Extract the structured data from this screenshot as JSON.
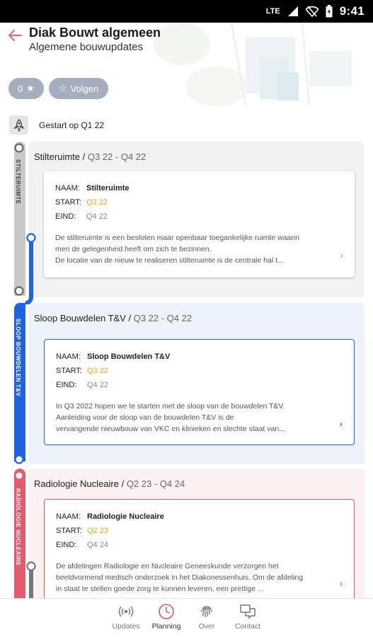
{
  "status_bar": {
    "network": "LTE",
    "time": "9:41"
  },
  "header": {
    "title": "Diak Bouwt algemeen",
    "subtitle": "Algemene bouwupdates",
    "rating_count": "0",
    "follow_label": "Volgen"
  },
  "timeline": {
    "start_label": "Gestart op Q1 22",
    "phases": [
      {
        "rail_label": "STILTERUIMTE",
        "title": "Stilteruimte",
        "dates": "Q3 22 - Q4 22",
        "card": {
          "name_key": "NAAM:",
          "name": "Stilteruimte",
          "start_key": "START:",
          "start": "Q3 22",
          "end_key": "EIND:",
          "end": "Q4 22",
          "desc1": "De stilteruimte is een besloten maar openbaar toegankelijke ruimte waarin",
          "desc2": "men de gelegenheid heeft om zich te bezinnen.",
          "desc3": "De locatie van de nieuw te realiseren stilteruimte is de centrale hal t..."
        }
      },
      {
        "rail_label": "SLOOP BOUWDELEN T&V",
        "title": "Sloop Bouwdelen T&V",
        "dates": "Q3 22 - Q4 22",
        "card": {
          "name_key": "NAAM:",
          "name": "Sloop Bouwdelen T&V",
          "start_key": "START:",
          "start": "Q3 22",
          "end_key": "EIND:",
          "end": "Q4 22",
          "desc1": "In Q3 2022 hopen we te starten met de sloop van de bouwdelen T&V.",
          "desc2": "Aanleiding voor de sloop van de bouwdelen T&V is de",
          "desc3": "vervangende nieuwbouw van VKC en klinieken en slechte staat van..."
        }
      },
      {
        "rail_label": "RADIOLOGIE NUCLEAIRE",
        "title": "Radiologie Nucleaire",
        "dates": "Q2 23 - Q4 24",
        "card": {
          "name_key": "NAAM:",
          "name": "Radiologie Nucleaire",
          "start_key": "START:",
          "start": "Q2 23",
          "end_key": "EIND:",
          "end": "Q4 24",
          "desc1": "De afdelingen Radiologie en Nucleaire Geneeskunde verzorgen het",
          "desc2": "beeldvormend medisch onderzoek in het Diakonessenhuis. Om de afdeling",
          "desc3": "in staat te stellen goede zorg te kunnen leveren, een prettige ..."
        }
      }
    ]
  },
  "bottom_nav": {
    "items": [
      {
        "label": "Updates"
      },
      {
        "label": "Planning"
      },
      {
        "label": "Over"
      },
      {
        "label": "Contact"
      }
    ]
  },
  "colors": {
    "accent": "#e06b75",
    "phase_grey": "#f2f2f2",
    "phase_blue": "#eef3fb",
    "phase_pink": "#fcf1f2",
    "rail_grey": "#c9c9c9",
    "rail_blue": "#1f63e0",
    "rail_pink": "#e35a6d",
    "start_orange": "#e8a317"
  }
}
